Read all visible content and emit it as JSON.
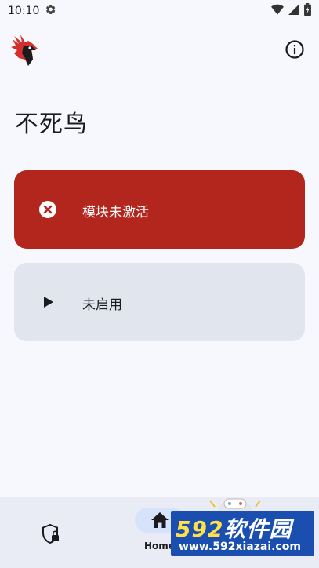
{
  "status_bar": {
    "time": "10:10",
    "icons": [
      "settings-icon",
      "wifi-icon",
      "signal-icon",
      "battery-icon"
    ]
  },
  "app_bar": {
    "logo": "phoenix-logo",
    "info_icon": "info-icon"
  },
  "title": "不死鸟",
  "cards": {
    "status": {
      "icon": "error-icon",
      "label": "模块未激活",
      "color": "#b3261e"
    },
    "mode": {
      "icon": "play-icon",
      "label": "未启用",
      "color": "#e1e5ee"
    }
  },
  "bottom_nav": {
    "items": [
      {
        "icon": "shield-lock-icon"
      },
      {
        "icon": "home-icon",
        "label": "Home"
      }
    ]
  },
  "watermark": {
    "num": "592",
    "text": "软件园",
    "url": "www.592xiazai.com"
  }
}
